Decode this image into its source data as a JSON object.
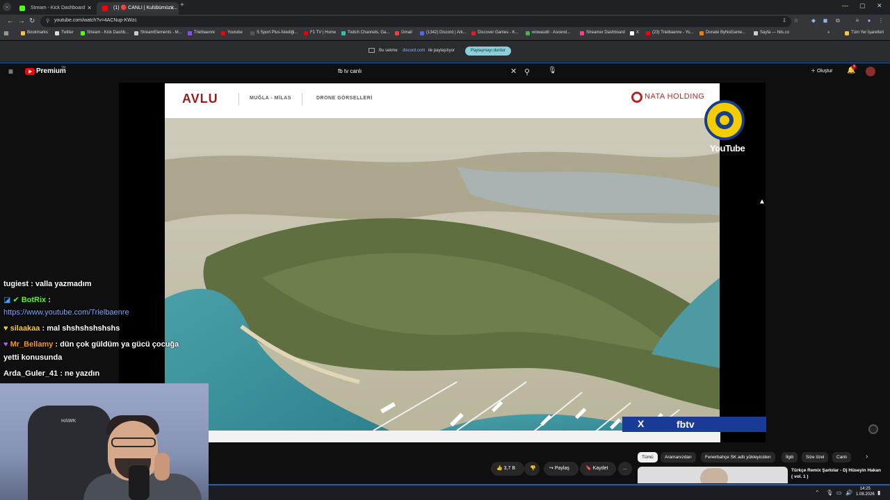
{
  "browser": {
    "tabs": [
      {
        "label": "Stream - Kick Dashboard",
        "color": "#53fc18",
        "active": false
      },
      {
        "label": "(1) 🔴 CANLI | Kulübümüzü...",
        "color": "#ff0000",
        "active": true
      }
    ],
    "url": "youtube.com/watch?v=4ACNup-KWzc",
    "bookmarks": [
      {
        "label": "Bookmarks",
        "color": "#f5c542"
      },
      {
        "label": "Twitter",
        "color": "#dddddd"
      },
      {
        "label": "Stream - Kick Dashb...",
        "color": "#53fc18"
      },
      {
        "label": "StreamElements - M...",
        "color": "#cccccc"
      },
      {
        "label": "Trielbaenre",
        "color": "#9146ff"
      },
      {
        "label": "Youtube",
        "color": "#ff0000"
      },
      {
        "label": "S Sport Plus-İstediği...",
        "color": "#222222"
      },
      {
        "label": "F1 TV | Home",
        "color": "#e10600"
      },
      {
        "label": "Twitch Channels, Ga...",
        "color": "#2dc5a5"
      },
      {
        "label": "Gmail",
        "color": "#ea4335"
      },
      {
        "label": "(1342) Discord | Ark...",
        "color": "#5865f2"
      },
      {
        "label": "Discover Games - K...",
        "color": "#e02020"
      },
      {
        "label": "wowaudit - Ascend...",
        "color": "#4caf50"
      },
      {
        "label": "Streamer Dashboard",
        "color": "#ff4081"
      },
      {
        "label": "X",
        "color": "#ffffff"
      },
      {
        "label": "(23) Trielbaenre - Yo...",
        "color": "#ff0000"
      },
      {
        "label": "Donate ByNoGame...",
        "color": "#f57c00"
      },
      {
        "label": "Sayfa — hits.co",
        "color": "#cccccc"
      }
    ],
    "all_bookmarks": "Tüm Yer İşaretleri"
  },
  "share_bar": {
    "prefix": "Bu sekme",
    "domain": "discord.com",
    "suffix": "ile paylaşılıyor",
    "stop_label": "Paylaşmayı durdur"
  },
  "youtube": {
    "brand": "Premium",
    "region": "TR",
    "search_query": "fb tv canlı",
    "create_label": "Oluştur",
    "notif_count": "9"
  },
  "slide": {
    "brand": "AVLU",
    "location": "MUĞLA - MİLAS",
    "subtitle": "DRONE GÖRSELLERİ",
    "company": "NATA HOLDING"
  },
  "overlay": {
    "youtube_label": "YouTube",
    "x_icon": "X",
    "channel": "fbtv"
  },
  "actions": {
    "likes": "3,7 B",
    "share": "Paylaş",
    "save": "Kaydet",
    "more": "..."
  },
  "chips": [
    "Tümü",
    "Aramanızdan",
    "Fenerbahçe SK adlı yükleyiciden",
    "İlgili",
    "Size özel",
    "Canlı"
  ],
  "recommendation": {
    "title": "Türkçe Remix Şarkılar - Dj Hüseyin Hakan ( vol. 1 )"
  },
  "chat": [
    {
      "user": "tugiest",
      "message": " : valla yazmadım"
    },
    {
      "user": "BotRix",
      "message": " :"
    },
    {
      "user": "",
      "message": "https://www.youtube.com/Trielbaenre"
    },
    {
      "user": "silaakaa",
      "message": " : mal shshshshshshs"
    },
    {
      "user": "Mr_Bellamy",
      "message": " : dün çok güldüm ya gücü çocuğa"
    },
    {
      "user": "",
      "message": "yetti konusunda"
    },
    {
      "user": "Arda_Guler_41",
      "message": " : ne yazdın"
    }
  ],
  "webcam": {
    "chair_brand": "HAWK"
  },
  "taskbar": {
    "time": "14:25",
    "date": "1.08.2026"
  }
}
